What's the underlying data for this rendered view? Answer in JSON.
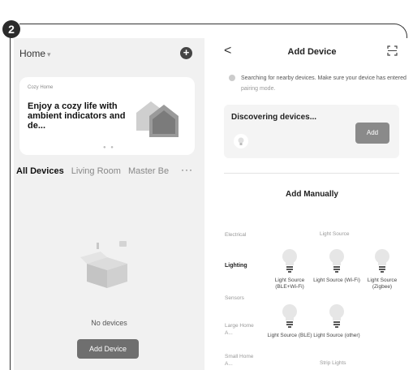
{
  "step_number": "2",
  "left_screen": {
    "home_label": "Home",
    "home_caret": "▾",
    "add_button": "+",
    "promo": {
      "small_label": "Cozy Home",
      "title": "Enjoy a cozy life with ambient indicators and de..."
    },
    "carousel_dots": "● ●",
    "tabs": [
      "All Devices",
      "Living Room",
      "Master Be"
    ],
    "more": "···",
    "empty_text": "No devices",
    "add_device_button": "Add Device"
  },
  "right_screen": {
    "back": "<",
    "title": "Add Device",
    "search_text": "Searching for nearby devices. Make sure your device has entered",
    "search_link": "pairing mode.",
    "discovering_title": "Discovering devices...",
    "discover_add_button": "Add",
    "manual_title": "Add Manually",
    "categories": [
      "Electrical",
      "Lighting",
      "Sensors",
      "Large Home A...",
      "Small Home A..."
    ],
    "active_category": "Lighting",
    "subheads": [
      "Light Source",
      "Strip Lights"
    ],
    "products": [
      {
        "label": "Light Source (BLE+Wi-Fi)"
      },
      {
        "label": "Light Source (Wi-Fi)"
      },
      {
        "label": "Light Source (Zigbee)"
      },
      {
        "label": "Light Source (BLE)"
      },
      {
        "label": "Light Source (other)"
      }
    ]
  }
}
